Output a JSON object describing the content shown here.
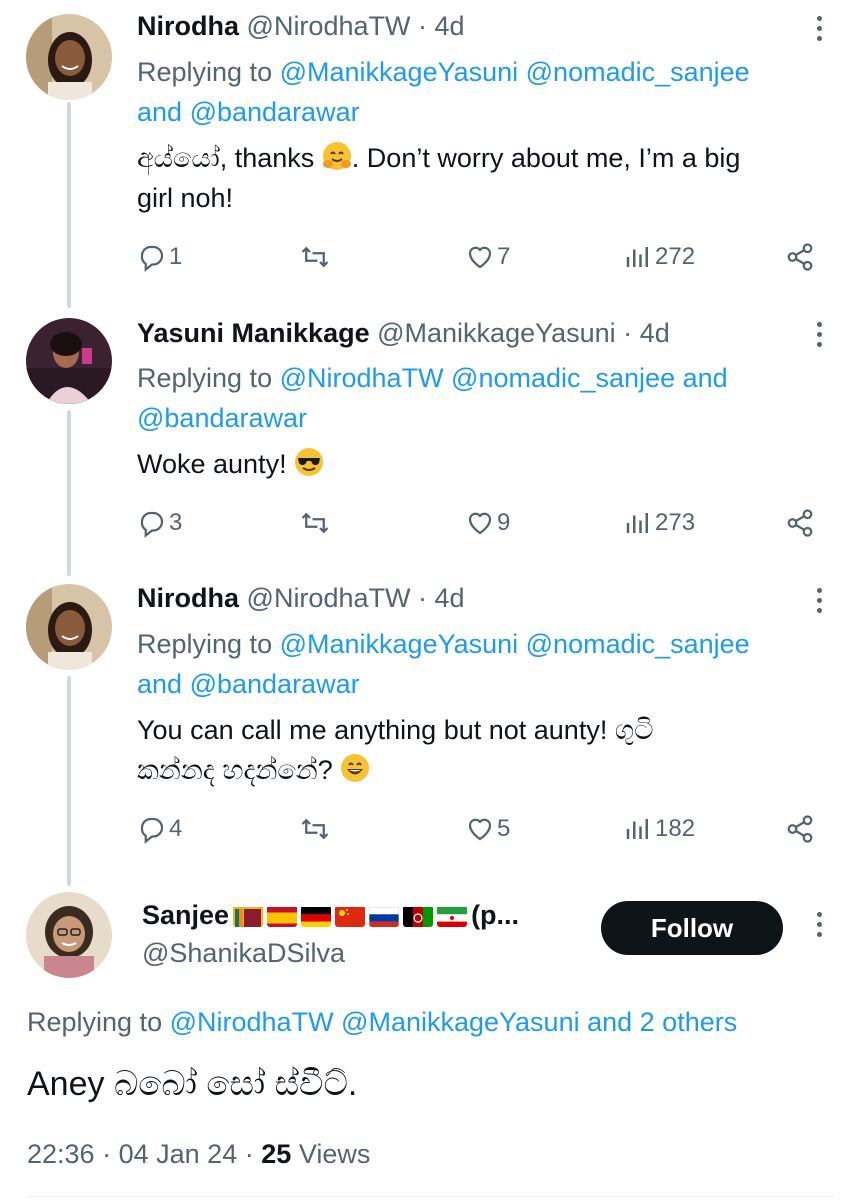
{
  "thread": [
    {
      "name": "Nirodha",
      "handle": "@NirodhaTW",
      "separator": "·",
      "age": "4d",
      "replying_prefix": "Replying to",
      "replying_line1": "@ManikkageYasuni @nomadic_sanjee",
      "replying_and": "and",
      "replying_last": "@bandarawar",
      "text_before_emoji": "අය්යෝ, thanks",
      "emoji": "hugging-face",
      "text_after_emoji": ". Don’t worry about me, I’m a big",
      "text_line2": "girl noh!",
      "replies": "1",
      "retweets": "",
      "likes": "7",
      "views": "272"
    },
    {
      "name": "Yasuni Manikkage",
      "handle": "@ManikkageYasuni",
      "separator": "·",
      "age": "4d",
      "replying_prefix": "Replying to",
      "replying_line1": "@NirodhaTW @nomadic_sanjee",
      "replying_and": "and",
      "replying_last": "@bandarawar",
      "text": "Woke aunty!",
      "emoji": "sunglasses-face",
      "replies": "3",
      "retweets": "",
      "likes": "9",
      "views": "273"
    },
    {
      "name": "Nirodha",
      "handle": "@NirodhaTW",
      "separator": "·",
      "age": "4d",
      "replying_prefix": "Replying to",
      "replying_line1": "@ManikkageYasuni @nomadic_sanjee",
      "replying_and": "and",
      "replying_last": "@bandarawar",
      "text_line1": "You can call me anything but not aunty! ගුටි",
      "text_line2": "කන්නද හදන්නේ?",
      "emoji": "grinning-face",
      "replies": "4",
      "retweets": "",
      "likes": "5",
      "views": "182"
    }
  ],
  "main_tweet": {
    "name": "Sanjee",
    "name_suffix": "(p...",
    "flags": [
      "sri-lanka",
      "spain",
      "germany",
      "china",
      "russia",
      "afghanistan",
      "iran"
    ],
    "handle": "@ShanikaDSilva",
    "follow_label": "Follow",
    "replying_prefix": "Replying to",
    "replying_mentions": "@NirodhaTW @ManikkageYasuni",
    "replying_others": "and 2 others",
    "text": "Aney බබෝ සෝ ස්වීට්.",
    "time": "22:36",
    "date": "04 Jan 24",
    "separator": "·",
    "views_count": "25",
    "views_label": "Views"
  },
  "colors": {
    "link": "#1d9bf0",
    "muted": "#536471",
    "text": "#0f1419",
    "thread_line": "#cfd9de",
    "follow_bg": "#0f1419"
  },
  "icons": {
    "reply": "reply-icon",
    "retweet": "retweet-icon",
    "like": "heart-icon",
    "views": "views-chart-icon",
    "share": "share-icon",
    "more": "more-options-icon"
  }
}
